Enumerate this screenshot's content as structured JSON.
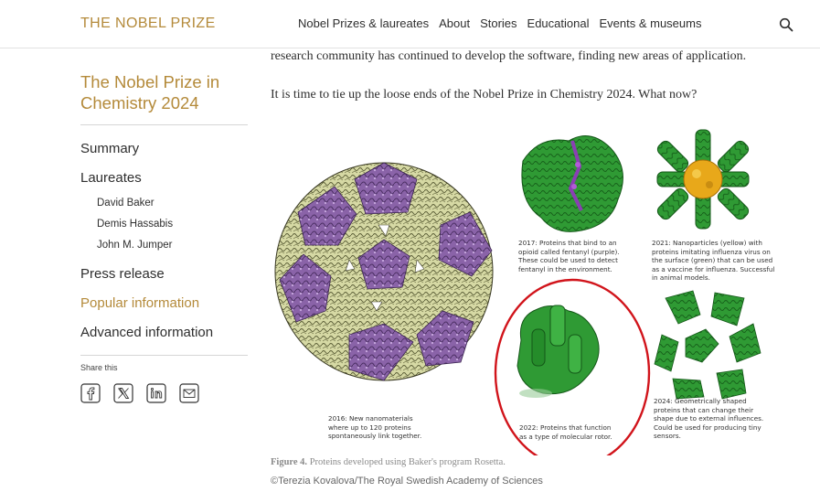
{
  "header": {
    "brand": "THE NOBEL PRIZE",
    "nav": [
      "Nobel Prizes & laureates",
      "About",
      "Stories",
      "Educational",
      "Events & museums"
    ]
  },
  "sidebar": {
    "title": "The Nobel Prize in Chemistry 2024",
    "items": [
      {
        "label": "Summary"
      },
      {
        "label": "Laureates"
      }
    ],
    "laureates": [
      "David Baker",
      "Demis Hassabis",
      "John M. Jumper"
    ],
    "items2": [
      {
        "label": "Press release"
      },
      {
        "label": "Popular information"
      },
      {
        "label": "Advanced information"
      }
    ],
    "share_label": "Share this"
  },
  "main": {
    "para1": "research community has continued to develop the software, finding new areas of application.",
    "para2": "It is time to tie up the loose ends of the Nobel Prize in Chemistry 2024. What now?",
    "figure": {
      "cap2016": [
        "2016: New nanomaterials",
        "where up to 120 proteins",
        "spontaneously link together."
      ],
      "cap2017": [
        "2017: Proteins that bind to an",
        "opioid called fentanyl (purple).",
        "These could be used to detect",
        "fentanyl in the environment."
      ],
      "cap2021": [
        "2021: Nanoparticles (yellow) with",
        "proteins imitating influenza virus on",
        "the surface (green) that can be used",
        "as a vaccine for influenza. Successful",
        "in animal models."
      ],
      "cap2022": [
        "2022: Proteins that function",
        "as a type of molecular rotor."
      ],
      "cap2024": [
        "2024: Geometrically shaped",
        "proteins that can change their",
        "shape due to external influences.",
        "Could be used for producing tiny",
        "sensors."
      ]
    },
    "caption_label": "Figure 4.",
    "caption_text": " Proteins developed using Baker's program Rosetta.",
    "credit": "©Terezia Kovalova/The Royal Swedish Academy of Sciences"
  },
  "colors": {
    "accent": "#b48a3a",
    "protein_green": "#2f9a34",
    "protein_purple": "#8a63a8",
    "protein_cream": "#d6d9a4",
    "nanoparticle_yellow": "#e8a81a",
    "highlight_red": "#d1141b"
  }
}
